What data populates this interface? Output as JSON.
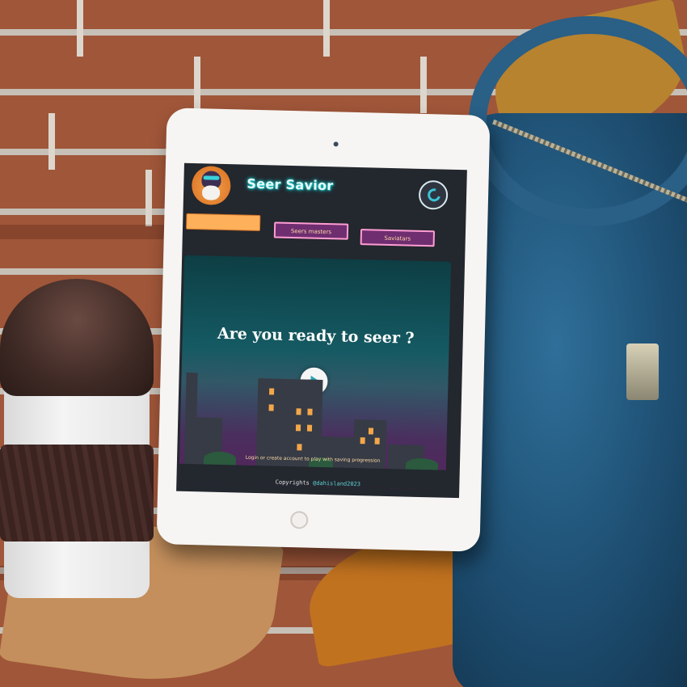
{
  "app": {
    "title": "Seer Savior"
  },
  "nav": {
    "home_label": "",
    "seers_masters_label": "Seers masters",
    "saviatars_label": "Saviatars"
  },
  "hero": {
    "headline": "Are you ready to seer ?",
    "note": "Login or create account to play with saving progression"
  },
  "footer": {
    "prefix": "Copyrights ",
    "handle": "@dahisland2023"
  },
  "colors": {
    "nav_active": "#ffb05a",
    "nav_inactive": "#6e2e70",
    "nav_border": "#ff9dd4",
    "title_glow": "#19d2d4",
    "hero_top": "#0d3e44",
    "hero_bottom": "#54245a",
    "window_light": "#f3a74a"
  },
  "icons": {
    "logo": "owl-mascot-icon",
    "avatar": "user-avatar-icon",
    "play": "play-icon"
  }
}
